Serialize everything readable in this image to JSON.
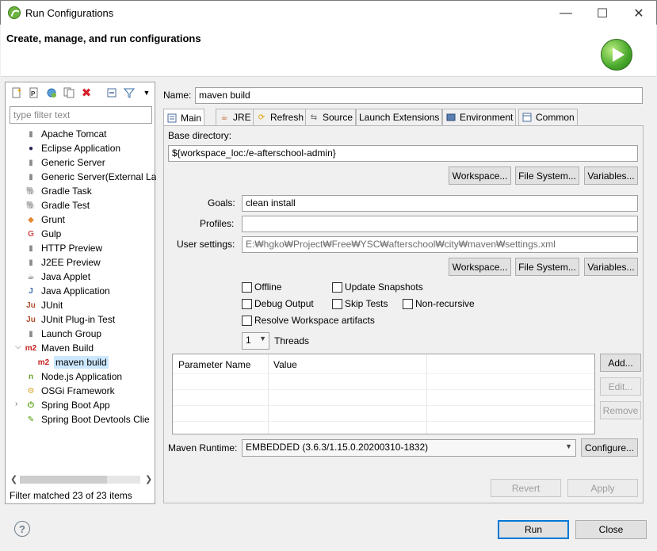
{
  "window": {
    "title": "Run Configurations",
    "minimize": "—",
    "maximize": "☐",
    "close": "✕"
  },
  "header": {
    "title": "Create, manage, and run configurations"
  },
  "left": {
    "filter_placeholder": "type filter text",
    "items": [
      {
        "label": "Apache Tomcat",
        "icon": "tomcat-icon",
        "glyph": "▮",
        "color": "#8b8b8b"
      },
      {
        "label": "Eclipse Application",
        "icon": "eclipse-icon",
        "glyph": "●",
        "color": "#2c2255"
      },
      {
        "label": "Generic Server",
        "icon": "server-icon",
        "glyph": "▮",
        "color": "#8b8b8b"
      },
      {
        "label": "Generic Server(External La",
        "icon": "server-icon",
        "glyph": "▮",
        "color": "#8b8b8b"
      },
      {
        "label": "Gradle Task",
        "icon": "gradle-icon",
        "glyph": "🐘",
        "color": "#02303a"
      },
      {
        "label": "Gradle Test",
        "icon": "gradle-icon",
        "glyph": "🐘",
        "color": "#02303a"
      },
      {
        "label": "Grunt",
        "icon": "grunt-icon",
        "glyph": "◆",
        "color": "#e48632"
      },
      {
        "label": "Gulp",
        "icon": "gulp-icon",
        "glyph": "G",
        "color": "#cf4647"
      },
      {
        "label": "HTTP Preview",
        "icon": "http-preview-icon",
        "glyph": "▮",
        "color": "#8b8b8b"
      },
      {
        "label": "J2EE Preview",
        "icon": "j2ee-preview-icon",
        "glyph": "▮",
        "color": "#8b8b8b"
      },
      {
        "label": "Java Applet",
        "icon": "java-applet-icon",
        "glyph": "☕",
        "color": "#555"
      },
      {
        "label": "Java Application",
        "icon": "java-application-icon",
        "glyph": "J",
        "color": "#3b6db5"
      },
      {
        "label": "JUnit",
        "icon": "junit-icon",
        "glyph": "Ju",
        "color": "#b04c2a"
      },
      {
        "label": "JUnit Plug-in Test",
        "icon": "junit-plugin-icon",
        "glyph": "Ju",
        "color": "#b04c2a"
      },
      {
        "label": "Launch Group",
        "icon": "launch-group-icon",
        "glyph": "▮",
        "color": "#8b8b8b"
      },
      {
        "label": "Maven Build",
        "icon": "maven-icon",
        "glyph": "m2",
        "color": "#c6201f"
      },
      {
        "label": "maven build",
        "icon": "maven-icon",
        "glyph": "m2",
        "color": "#c6201f"
      },
      {
        "label": "Node.js Application",
        "icon": "nodejs-icon",
        "glyph": "n",
        "color": "#6a9f2d"
      },
      {
        "label": "OSGi Framework",
        "icon": "osgi-icon",
        "glyph": "⚙",
        "color": "#d8a428"
      },
      {
        "label": "Spring Boot App",
        "icon": "spring-boot-icon",
        "glyph": "⏻",
        "color": "#4e9a06"
      },
      {
        "label": "Spring Boot Devtools Clie",
        "icon": "spring-devtools-icon",
        "glyph": "✎",
        "color": "#4e9a06"
      }
    ],
    "filter_status": "Filter matched 23 of 23 items"
  },
  "main": {
    "name_label": "Name:",
    "name_value": "maven build",
    "tabs": [
      "Main",
      "JRE",
      "Refresh",
      "Source",
      "Launch Extensions",
      "Environment",
      "Common"
    ],
    "base_dir_label": "Base directory:",
    "base_dir_value": "${workspace_loc:/e-afterschool-admin}",
    "btn_workspace": "Workspace...",
    "btn_filesystem": "File System...",
    "btn_variables": "Variables...",
    "goals_label": "Goals:",
    "goals_value": "clean install",
    "profiles_label": "Profiles:",
    "profiles_value": "",
    "user_settings_label": "User settings:",
    "user_settings_value": "E:₩hgko₩Project₩Free₩YSC₩afterschool₩city₩maven₩settings.xml",
    "chk_offline": "Offline",
    "chk_update": "Update Snapshots",
    "chk_debug": "Debug Output",
    "chk_skip": "Skip Tests",
    "chk_nonrec": "Non-recursive",
    "chk_resolve": "Resolve Workspace artifacts",
    "threads_value": "1",
    "threads_label": "Threads",
    "param_col_name": "Parameter Name",
    "param_col_value": "Value",
    "btn_add": "Add...",
    "btn_edit": "Edit...",
    "btn_remove": "Remove",
    "runtime_label": "Maven Runtime:",
    "runtime_value": "EMBEDDED (3.6.3/1.15.0.20200310-1832)",
    "btn_configure": "Configure...",
    "btn_revert": "Revert",
    "btn_apply": "Apply"
  },
  "footer": {
    "help": "?",
    "run": "Run",
    "close": "Close"
  }
}
